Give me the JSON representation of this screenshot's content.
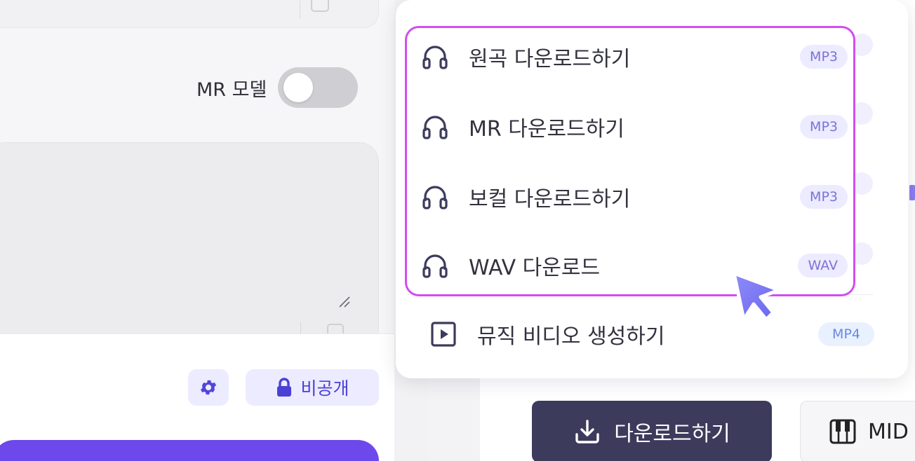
{
  "form": {
    "mr_model_label": "MR 모델",
    "mr_model_enabled": false,
    "visibility_label": "비공개"
  },
  "download_menu": {
    "items": [
      {
        "label": "원곡 다운로드하기",
        "format": "MP3"
      },
      {
        "label": "MR 다운로드하기",
        "format": "MP3"
      },
      {
        "label": "보컬 다운로드하기",
        "format": "MP3"
      },
      {
        "label": "WAV 다운로드",
        "format": "WAV"
      }
    ],
    "video_item": {
      "label": "뮤직 비디오 생성하기",
      "format": "MP4"
    }
  },
  "actions": {
    "download_label": "다운로드하기",
    "midi_label": "MID"
  },
  "colors": {
    "accent": "#6d48ea",
    "highlight_border": "#d24df0",
    "dark_button": "#3d3b5c",
    "badge_bg": "#ecebff",
    "badge_text": "#7b73d6",
    "cursor": "#7f7cf4"
  },
  "icons": {
    "menu_item": "headphones-icon",
    "video_item": "play-square-icon",
    "download": "download-icon",
    "midi": "piano-icon",
    "settings": "gear-icon",
    "private": "lock-icon"
  }
}
